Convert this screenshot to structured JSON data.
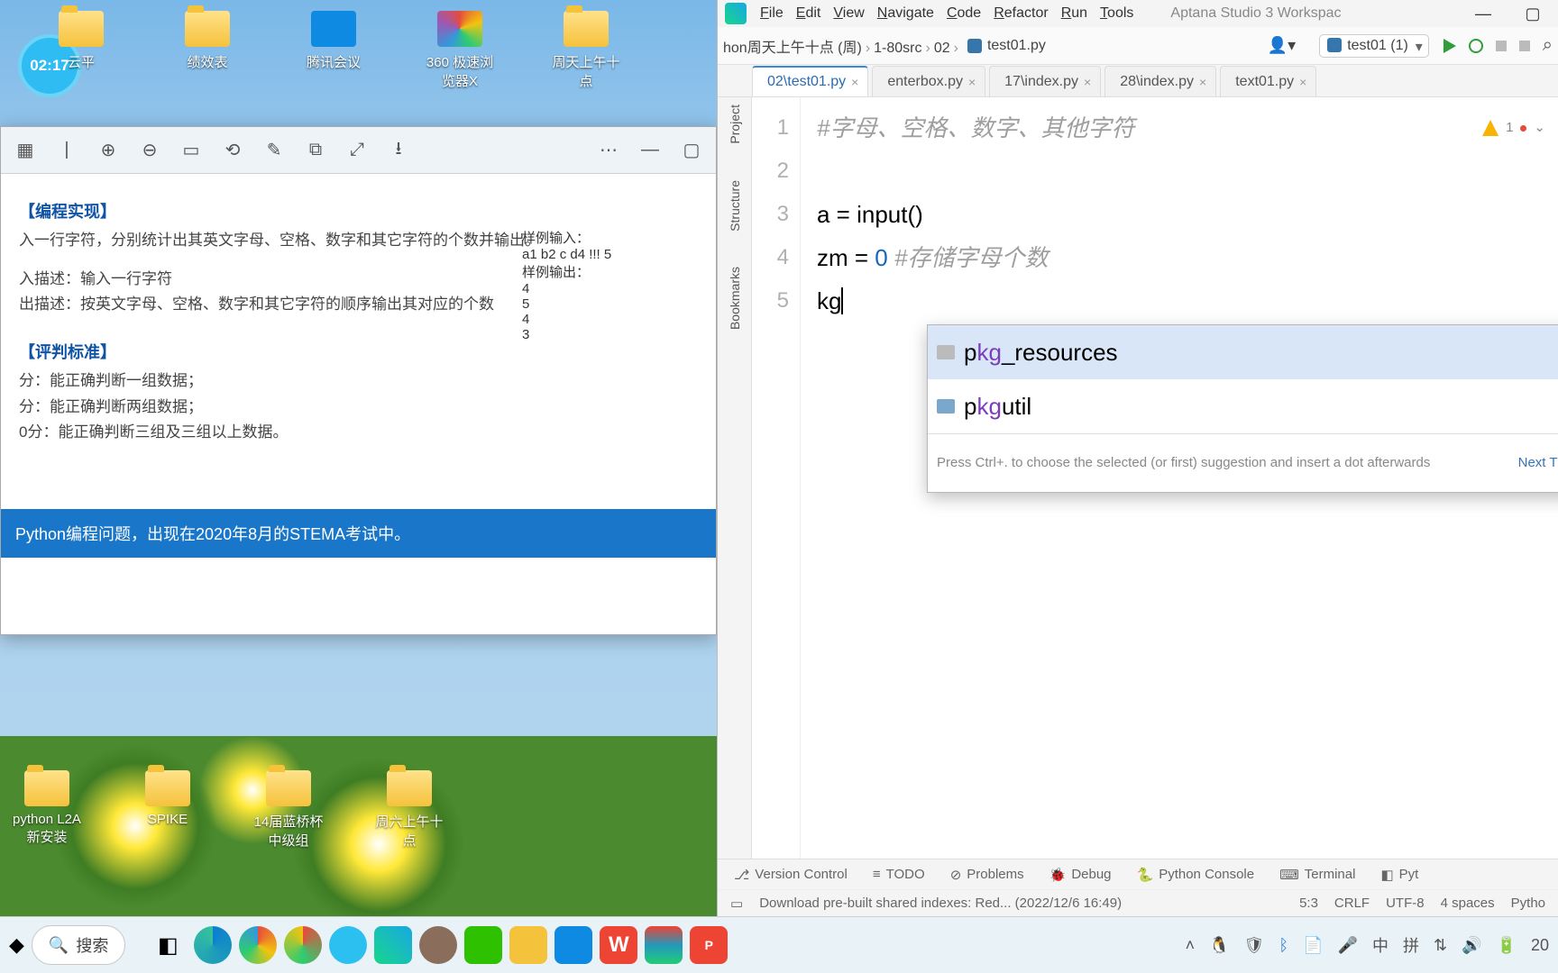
{
  "clock_overlay": "02:17",
  "desktop_icons_top": [
    {
      "label": "云平",
      "kind": "folder"
    },
    {
      "label": "绩效表",
      "kind": "folder"
    },
    {
      "label": "腾讯会议",
      "kind": "app1"
    },
    {
      "label": "360 极速浏览器X",
      "kind": "app2"
    },
    {
      "label": "周天上午十点",
      "kind": "folder"
    }
  ],
  "desktop_icons_bottom": [
    {
      "label": "python L2A 新安装",
      "kind": "folder"
    },
    {
      "label": "SPIKE",
      "kind": "file"
    },
    {
      "label": "14届蓝桥杯中级组",
      "kind": "folder"
    },
    {
      "label": "周六上午十点",
      "kind": "folder"
    }
  ],
  "viewer": {
    "section1_title": "【编程实现】",
    "line1": "入一行字符，分别统计出其英文字母、空格、数字和其它字符的个数并输出。",
    "line2": "入描述：输入一行字符",
    "line3": "出描述：按英文字母、空格、数字和其它字符的顺序输出其对应的个数",
    "section2_title": "【评判标准】",
    "crit1": "分：能正确判断一组数据；",
    "crit2": "分：能正确判断两组数据；",
    "crit3": "0分：能正确判断三组及三组以上数据。",
    "example_in_label": "样例输入：",
    "example_in": "a1 b2 c d4 !!! 5",
    "example_out_label": "样例输出：",
    "example_out": [
      "4",
      "5",
      "4",
      "3"
    ],
    "footer": "Python编程问题，出现在2020年8月的STEMA考试中。"
  },
  "taskbar": {
    "search": "搜索"
  },
  "pycharm": {
    "menu": [
      "File",
      "Edit",
      "View",
      "Navigate",
      "Code",
      "Refactor",
      "Run",
      "Tools"
    ],
    "title": "Aptana Studio 3 Workspac",
    "breadcrumb": [
      "hon周天上午十点 (周)",
      "1-80src",
      "02"
    ],
    "breadcrumb_file": "test01.py",
    "run_config": "test01 (1)",
    "tabs": [
      {
        "label": "02\\test01.py",
        "active": true
      },
      {
        "label": "enterbox.py",
        "active": false
      },
      {
        "label": "17\\index.py",
        "active": false
      },
      {
        "label": "28\\index.py",
        "active": false
      },
      {
        "label": "text01.py",
        "active": false
      }
    ],
    "gutter": [
      "1",
      "2",
      "3",
      "4",
      "5"
    ],
    "code": {
      "l1_comment": "#字母、空格、数字、其他字符",
      "l3": "a = input()",
      "l4_pre": "zm = ",
      "l4_zero": "0",
      "l4_comment": " #存储字母个数",
      "l5": "kg"
    },
    "inspection": {
      "warn_count": "1",
      "err_count": ""
    },
    "autocomplete": {
      "items": [
        {
          "pre": "p",
          "match": "kg",
          "post": "_resources",
          "selected": true,
          "kind": "dir"
        },
        {
          "pre": "p",
          "match": "kg",
          "post": "util",
          "selected": false,
          "kind": "pkg"
        }
      ],
      "hint": "Press Ctrl+. to choose the selected (or first) suggestion and insert a dot afterwards",
      "hint_link": "Next Tip"
    },
    "side_tabs": [
      "Project",
      "Structure",
      "Bookmarks"
    ],
    "toolwindows": [
      "Version Control",
      "TODO",
      "Problems",
      "Debug",
      "Python Console",
      "Terminal",
      "Pyt"
    ],
    "status": {
      "msg": "Download pre-built shared indexes: Red... (2022/12/6 16:49)",
      "pos": "5:3",
      "eol": "CRLF",
      "enc": "UTF-8",
      "indent": "4 spaces",
      "lang": "Pytho"
    }
  }
}
